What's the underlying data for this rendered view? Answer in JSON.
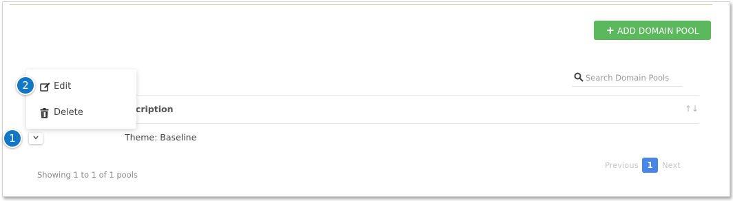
{
  "toolbar": {
    "add_label": "ADD DOMAIN POOL",
    "add_icon": "plus-icon",
    "accent": "#5cb85c"
  },
  "search": {
    "placeholder": "Search Domain Pools",
    "value": "",
    "icon": "search-icon"
  },
  "table": {
    "columns": [
      {
        "label": "escription",
        "sort_icon": "sort-icon"
      }
    ],
    "rows": [
      {
        "description": "Theme: Baseline"
      }
    ]
  },
  "row_menu": {
    "items": [
      {
        "label": "Edit",
        "icon": "edit-icon"
      },
      {
        "label": "Delete",
        "icon": "trash-icon"
      }
    ]
  },
  "footer": {
    "showing": "Showing 1 to 1 of 1 pools",
    "pagination": {
      "previous": "Previous",
      "current_page": "1",
      "next": "Next",
      "active_color": "#4a86e8"
    }
  },
  "callouts": [
    {
      "number": "1"
    },
    {
      "number": "2"
    }
  ],
  "colors": {
    "callout": "#1477c4"
  }
}
